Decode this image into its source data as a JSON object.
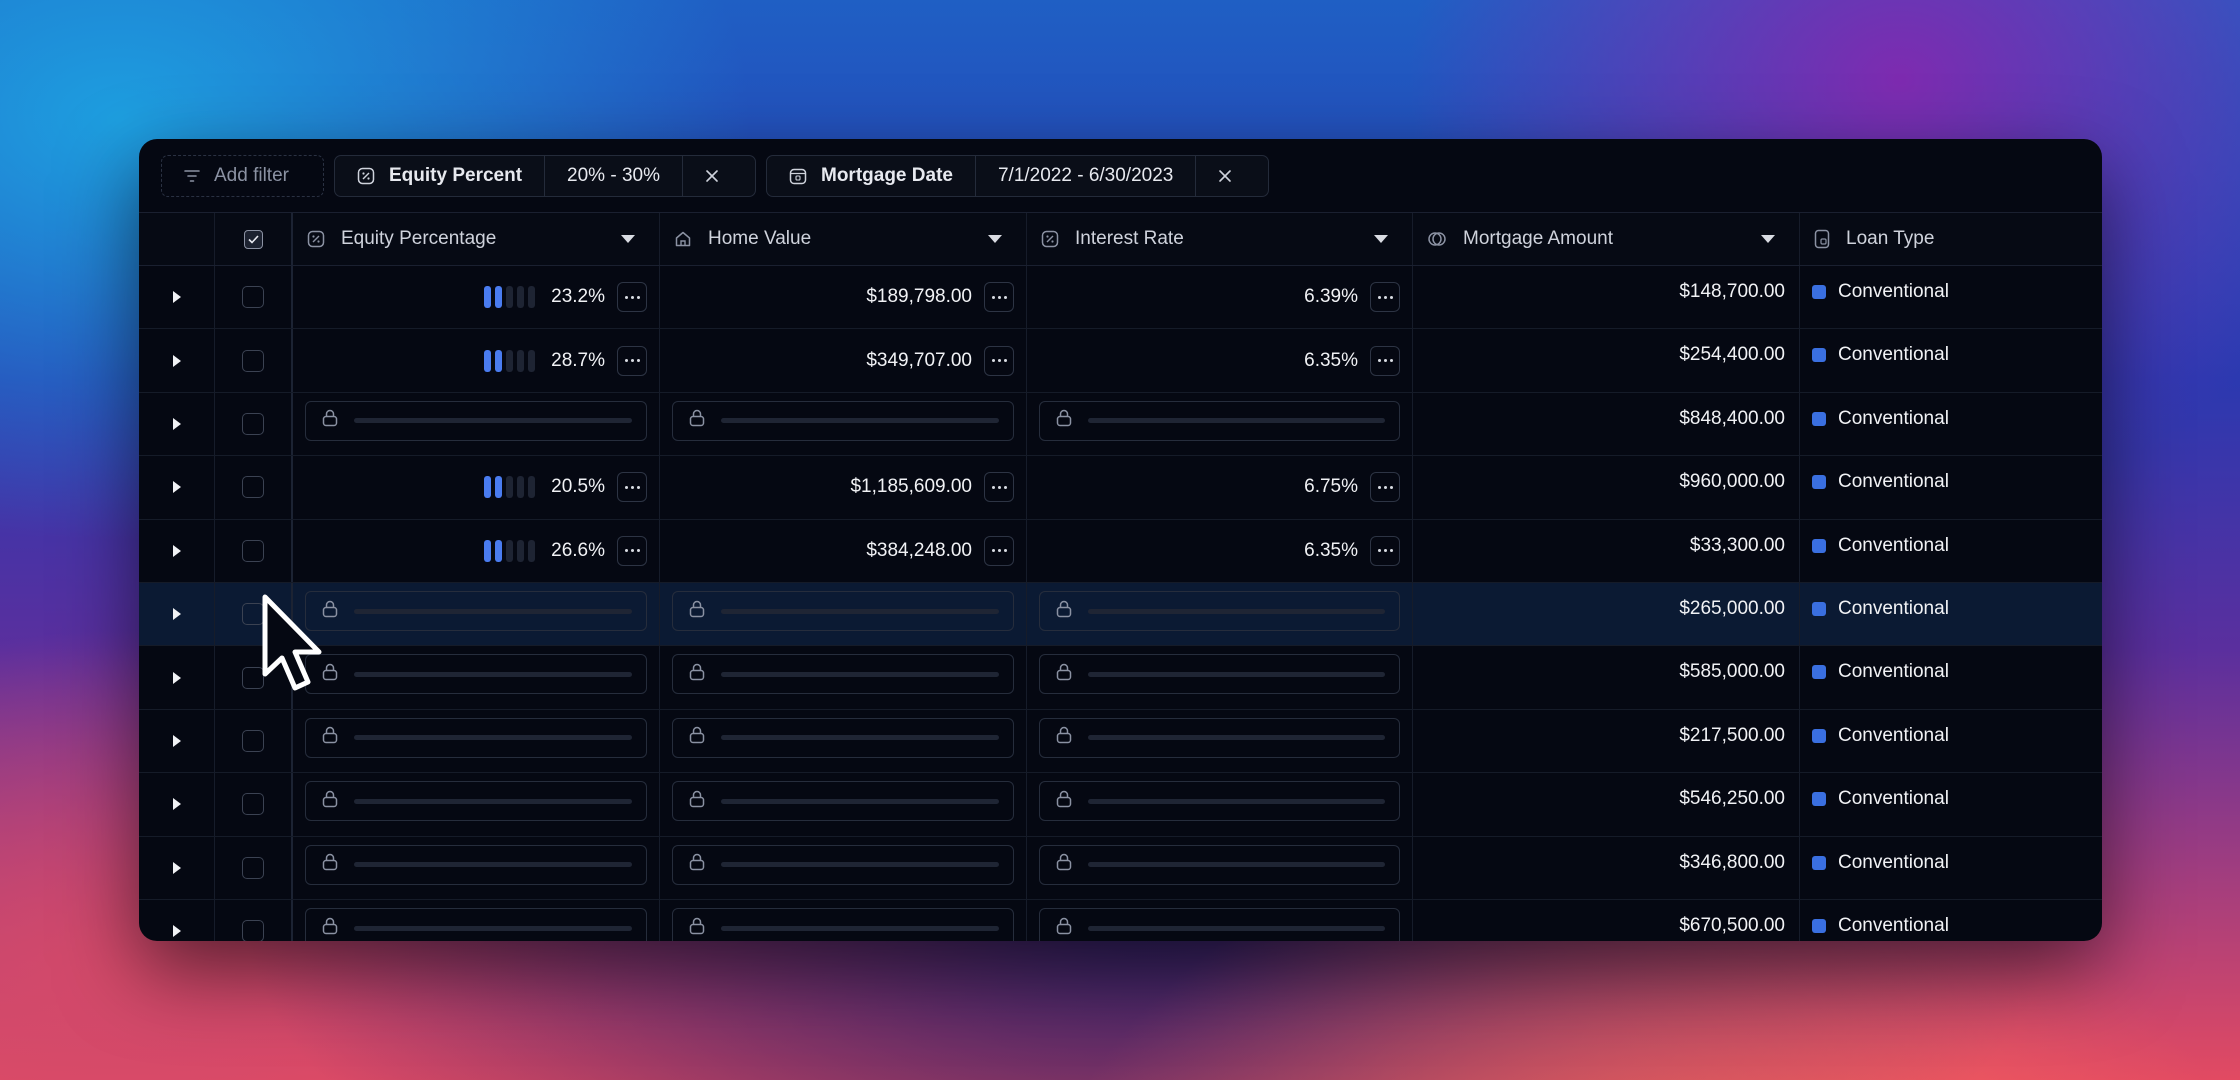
{
  "filters": {
    "add_filter_label": "Add filter",
    "equity": {
      "label": "Equity Percent",
      "value": "20% - 30%"
    },
    "mortgage_date": {
      "label": "Mortgage Date",
      "value": "7/1/2022 - 6/30/2023"
    }
  },
  "columns": {
    "equity": "Equity Percentage",
    "home_value": "Home Value",
    "interest_rate": "Interest Rate",
    "mortgage_amount": "Mortgage Amount",
    "loan_type": "Loan Type"
  },
  "rows": [
    {
      "locked": false,
      "equity": "23.2%",
      "equity_level": 2,
      "home_value": "$189,798.00",
      "interest_rate": "6.39%",
      "mortgage_amount": "$148,700.00",
      "loan_type": "Conventional"
    },
    {
      "locked": false,
      "equity": "28.7%",
      "equity_level": 2,
      "home_value": "$349,707.00",
      "interest_rate": "6.35%",
      "mortgage_amount": "$254,400.00",
      "loan_type": "Conventional"
    },
    {
      "locked": true,
      "mortgage_amount": "$848,400.00",
      "loan_type": "Conventional"
    },
    {
      "locked": false,
      "equity": "20.5%",
      "equity_level": 2,
      "home_value": "$1,185,609.00",
      "interest_rate": "6.75%",
      "mortgage_amount": "$960,000.00",
      "loan_type": "Conventional"
    },
    {
      "locked": false,
      "equity": "26.6%",
      "equity_level": 2,
      "home_value": "$384,248.00",
      "interest_rate": "6.35%",
      "mortgage_amount": "$33,300.00",
      "loan_type": "Conventional"
    },
    {
      "locked": true,
      "highlighted": true,
      "mortgage_amount": "$265,000.00",
      "loan_type": "Conventional"
    },
    {
      "locked": true,
      "mortgage_amount": "$585,000.00",
      "loan_type": "Conventional"
    },
    {
      "locked": true,
      "mortgage_amount": "$217,500.00",
      "loan_type": "Conventional"
    },
    {
      "locked": true,
      "mortgage_amount": "$546,250.00",
      "loan_type": "Conventional"
    },
    {
      "locked": true,
      "mortgage_amount": "$346,800.00",
      "loan_type": "Conventional"
    },
    {
      "locked": true,
      "mortgage_amount": "$670,500.00",
      "loan_type": "Conventional"
    }
  ],
  "icons": {
    "filter": "filter-lines-icon",
    "percent": "percent-icon",
    "calendar": "calendar-icon",
    "close": "close-icon",
    "home": "home-icon",
    "coins": "coins-icon",
    "loan": "document-icon",
    "lock": "lock-icon",
    "expand": "play-triangle-icon",
    "more": "more-dots-icon",
    "cursor": "mouse-pointer-icon"
  },
  "colors": {
    "accent": "#4a7cf0",
    "loan_badge": "#3a6fe0",
    "highlight_row": "#0b1a33"
  }
}
